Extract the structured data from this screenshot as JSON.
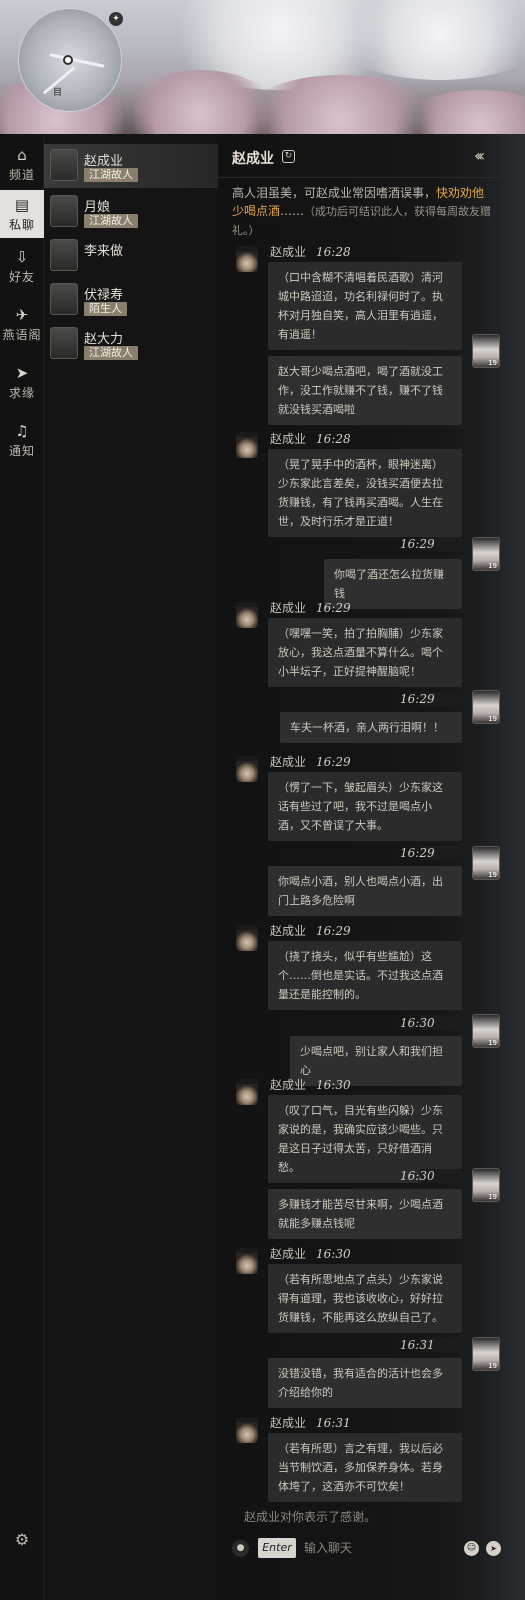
{
  "sidebar": {
    "items": [
      {
        "label": "频道",
        "icon": "home-icon"
      },
      {
        "label": "私聊",
        "icon": "chat-bubble-icon"
      },
      {
        "label": "好友",
        "icon": "friend-icon"
      },
      {
        "label": "燕语阁",
        "icon": "swallow-icon"
      },
      {
        "label": "求缘",
        "icon": "send-icon"
      },
      {
        "label": "通知",
        "icon": "bell-icon"
      }
    ],
    "active": "私聊",
    "settings_icon": "gear-icon"
  },
  "minimap": {
    "marker_label": "目"
  },
  "contacts": [
    {
      "name": "赵成业",
      "tag": "江湖故人",
      "active": true
    },
    {
      "name": "月娘",
      "tag": "江湖故人",
      "active": false
    },
    {
      "name": "李来做",
      "tag": "",
      "active": false
    },
    {
      "name": "伏禄寿",
      "tag": "陌生人",
      "active": false
    },
    {
      "name": "赵大力",
      "tag": "江湖故人",
      "active": false
    }
  ],
  "chat": {
    "title": "赵成业",
    "intro_prefix": "高人泪虽美，可赵成业常因嗜酒误事，",
    "intro_highlight": "快劝劝他少喝点酒",
    "intro_suffix": "……",
    "intro_note": "（成功后可结识此人，获得每周故友赠礼。）",
    "messages": [
      {
        "from": "npc",
        "name": "赵成业",
        "time": "16:28",
        "text": "（口中含糊不清唱着民酒歌）清河城中路迢迢，功名利禄何时了。执杯对月独自笑，高人泪里有逍遥，有逍遥！"
      },
      {
        "from": "me",
        "level": "19",
        "text": "赵大哥少喝点酒吧，喝了酒就没工作，没工作就赚不了钱，赚不了钱就没钱买酒喝啦"
      },
      {
        "from": "npc",
        "name": "赵成业",
        "time": "16:28",
        "text": "（晃了晃手中的酒杯，眼神迷离）少东家此言差矣，没钱买酒便去拉货赚钱，有了钱再买酒喝。人生在世，及时行乐才是正道！"
      },
      {
        "from": "me",
        "time": "16:29",
        "level": "19",
        "text": "你喝了酒还怎么拉货赚钱"
      },
      {
        "from": "npc",
        "name": "赵成业",
        "time": "16:29",
        "text": "（嘿嘿一笑，拍了拍胸脯）少东家放心，我这点酒量不算什么。喝个小半坛子，正好提神醒脑呢！"
      },
      {
        "from": "me",
        "time": "16:29",
        "level": "19",
        "text": "车夫一杯酒，亲人两行泪啊！！"
      },
      {
        "from": "npc",
        "name": "赵成业",
        "time": "16:29",
        "text": "（愣了一下，皱起眉头）少东家这话有些过了吧，我不过是喝点小酒，又不曾误了大事。"
      },
      {
        "from": "me",
        "time": "16:29",
        "level": "19",
        "text": "你喝点小酒，别人也喝点小酒，出门上路多危险啊"
      },
      {
        "from": "npc",
        "name": "赵成业",
        "time": "16:29",
        "text": "（挠了挠头，似乎有些尴尬）这个……倒也是实话。不过我这点酒量还是能控制的。"
      },
      {
        "from": "me",
        "time": "16:30",
        "level": "19",
        "text": "少喝点吧，别让家人和我们担心"
      },
      {
        "from": "npc",
        "name": "赵成业",
        "time": "16:30",
        "text": "（叹了口气，目光有些闪躲）少东家说的是，我确实应该少喝些。只是这日子过得太苦，只好借酒消愁。"
      },
      {
        "from": "me",
        "time": "16:30",
        "level": "19",
        "text": "多赚钱才能苦尽甘来啊，少喝点酒就能多赚点钱呢"
      },
      {
        "from": "npc",
        "name": "赵成业",
        "time": "16:30",
        "text": "（若有所思地点了点头）少东家说得有道理，我也该收收心，好好拉货赚钱，不能再这么放纵自己了。"
      },
      {
        "from": "me",
        "time": "16:31",
        "level": "19",
        "text": "没错没错，我有适合的活计也会多介绍给你的"
      },
      {
        "from": "npc",
        "name": "赵成业",
        "time": "16:31",
        "text": "（若有所思）言之有理，我以后必当节制饮酒，多加保养身体。若身体垮了，这酒亦不可饮矣！"
      }
    ],
    "footer_note": "赵成业对你表示了感谢。",
    "input": {
      "enter_label": "Enter",
      "placeholder": "输入聊天"
    }
  }
}
